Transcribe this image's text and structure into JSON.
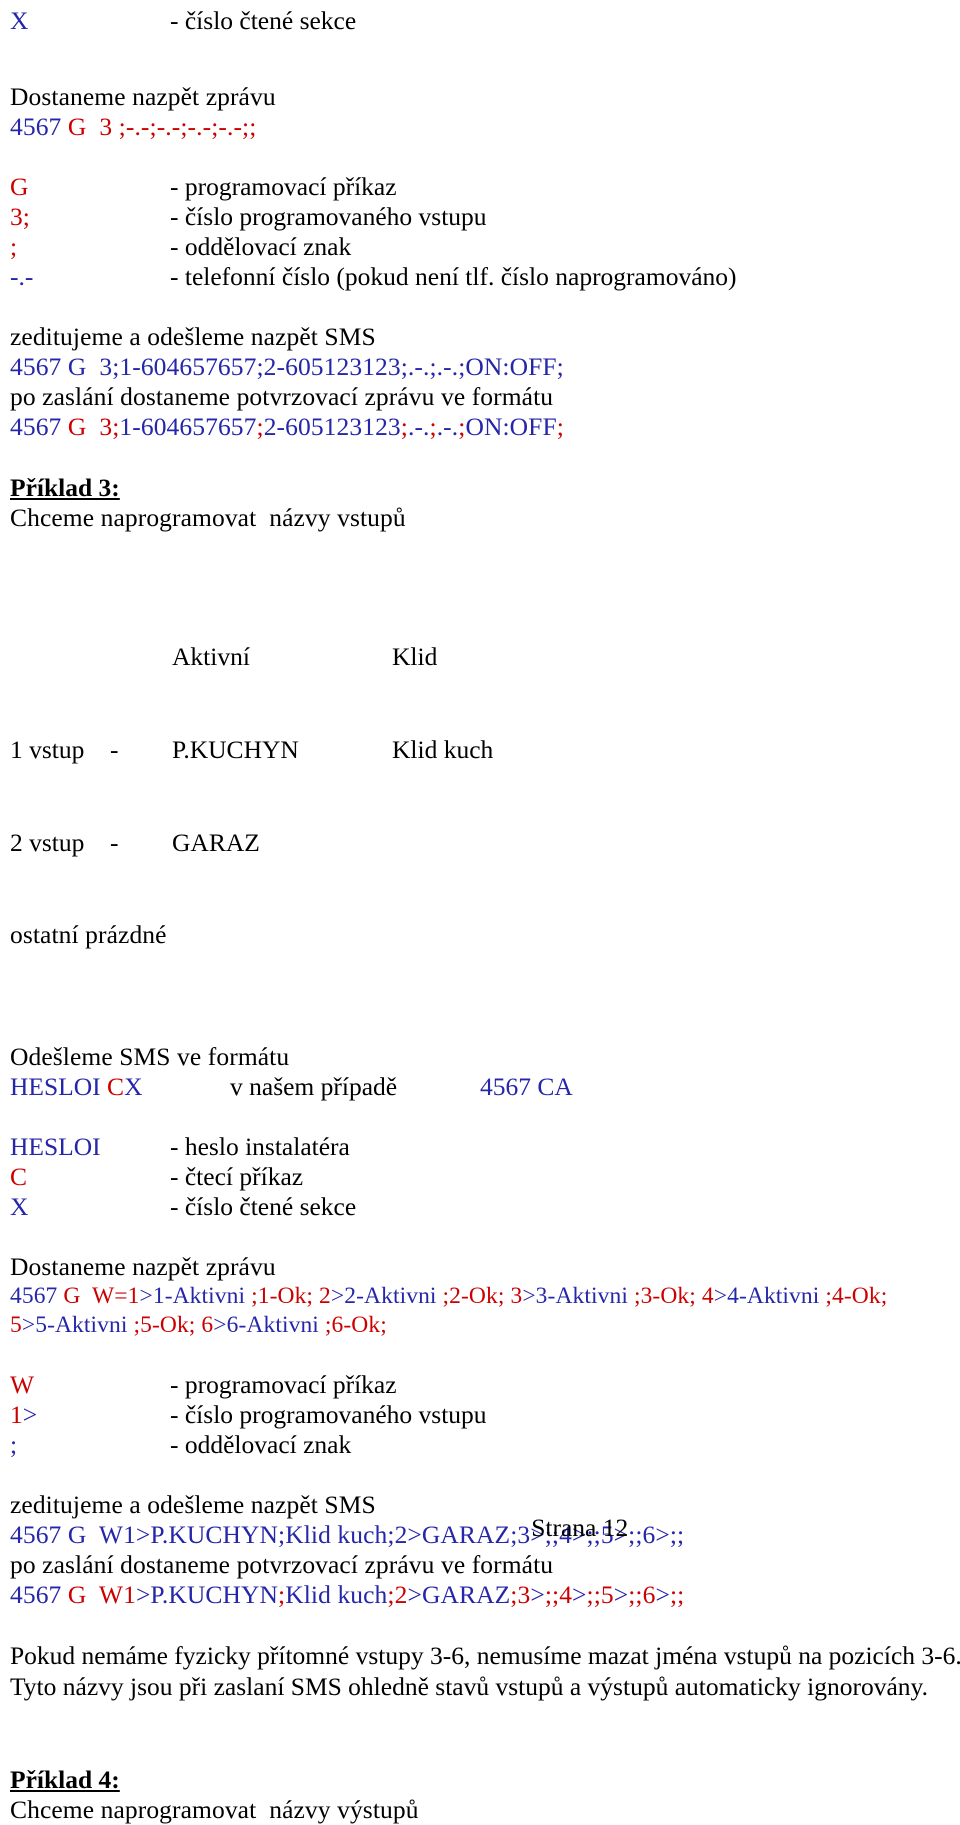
{
  "colors": {
    "blue": "#2526a9",
    "red": "#cc0000",
    "black": "#000000",
    "page_background": "#ffffff"
  },
  "section_read": {
    "legend_x_term": "X",
    "legend_x_desc": "- číslo čtené sekce",
    "reply_intro": "Dostaneme nazpět zprávu",
    "reply_prefix": "4567",
    "reply_cmd": "G",
    "reply_rest": "3 ;-.-;-.-;-.-;-.-;;",
    "legend": [
      {
        "term": "G",
        "desc": "- programovací příkaz"
      },
      {
        "term": "3;",
        "desc": "- číslo programovaného vstupu"
      },
      {
        "term": ";",
        "desc": "- oddělovací znak"
      },
      {
        "term": "-.-",
        "desc": "- telefonní číslo (pokud není tlf. číslo naprogramováno)"
      }
    ],
    "edit_intro": "zeditujeme a odešleme nazpět SMS",
    "edit_sms_prefix": "4567 G  3;1-604657657;2-605123123;.-.;.-.;ON:OFF;",
    "confirm_intro": "po zaslání dostaneme potvrzovací zprávu ve formátu",
    "confirm_num": "4567",
    "confirm_cmd": "G",
    "confirm_inp": "3",
    "confirm_sep1": ";",
    "confirm_body1": "1-604657657",
    "confirm_sep2": ";",
    "confirm_body2": "2-605123123",
    "confirm_sep3": ";",
    "confirm_body3": ".-.",
    "confirm_sep4": ";",
    "confirm_body4": ".-.",
    "confirm_sep5": ";",
    "confirm_body5": "ON:OFF",
    "confirm_sep6": ";"
  },
  "example3": {
    "heading": "Příklad 3:",
    "subtitle": "Chceme naprogramovat  názvy vstupů",
    "table": {
      "col_active": "Aktivní",
      "col_idle": "Klid",
      "rows": [
        {
          "label": "1 vstup",
          "dash": "-",
          "active": "P.KUCHYN",
          "idle": "Klid kuch"
        },
        {
          "label": "2 vstup",
          "dash": "-",
          "active": "GARAZ",
          "idle": ""
        }
      ],
      "note": "ostatní prázdné"
    },
    "send_intro": "Odešleme SMS ve formátu",
    "send_pass": "HESLOI",
    "send_cmd": "C",
    "send_sec": "X",
    "send_mid": "v našem případě",
    "send_example": "4567 CA",
    "legend": [
      {
        "term": "HESLOI",
        "desc": "- heslo instalatéra",
        "color": "blue"
      },
      {
        "term": "C",
        "desc": "- čtecí příkaz",
        "color": "red"
      },
      {
        "term": "X",
        "desc": "- číslo čtené sekce",
        "color": "blue"
      }
    ],
    "reply_intro": "Dostaneme nazpět zprávu",
    "reply_num": "4567",
    "reply_cmd": "G",
    "reply_w": "W=1",
    "reply_items": [
      {
        "gt": ">1-Aktivni ",
        "sep": ";1-Ok; "
      },
      {
        "idx": "2",
        "gt": ">2-Aktivni ",
        "sep": ";2-Ok; "
      },
      {
        "idx": "3",
        "gt": ">3-Aktivni ",
        "sep": ";3-Ok; "
      },
      {
        "idx": "4",
        "gt": ">4-Aktivni ",
        "sep": ";4-Ok;"
      }
    ],
    "reply_line2": [
      {
        "idx": "5",
        "gt": ">5-Aktivni ",
        "sep": ";5-Ok; "
      },
      {
        "idx": "6",
        "gt": ">6-Aktivni ",
        "sep": ";6-Ok;"
      }
    ],
    "legend2": [
      {
        "term": "W",
        "desc": "- programovací příkaz"
      },
      {
        "term": "1>",
        "desc": "- číslo programovaného vstupu"
      },
      {
        "term": ";",
        "desc": "- oddělovací znak"
      }
    ],
    "edit_intro": "zeditujeme a odešleme nazpět SMS",
    "edit_sms_num": "4567",
    "edit_sms_cmd": "G",
    "edit_sms_body": "W1>P.KUCHYN;Klid kuch;2>GARAZ;3>;;4>;;5>;;6>;;",
    "confirm_intro": "po zaslání dostaneme potvrzovací zprávu ve formátu",
    "confirm_num": "4567",
    "confirm_cmd": "G",
    "confirm_w": "W1",
    "confirm_gt1": ">P.KUCHYN",
    "confirm_s1": ";",
    "confirm_b1": "Klid kuch",
    "confirm_s2": ";",
    "confirm_i2": "2",
    "confirm_b2": ">GARAZ",
    "confirm_s3": ";",
    "confirm_i3": "3",
    "confirm_b3": ">",
    "confirm_s4": ";;",
    "confirm_i4": "4",
    "confirm_b4": ">",
    "confirm_s5": ";;",
    "confirm_i5": "5",
    "confirm_b5": ">",
    "confirm_s6": ";;",
    "confirm_i6": "6",
    "confirm_b6": ">",
    "confirm_s7": ";;",
    "note_line1": "Pokud nemáme fyzicky přítomné vstupy 3-6, nemusíme mazat jména vstupů na pozicích 3-6.",
    "note_line2": "Tyto názvy jsou při zaslaní SMS ohledně stavů vstupů a výstupů automaticky ignorovány."
  },
  "example4": {
    "heading": "Příklad 4:",
    "subtitle": "Chceme naprogramovat  názvy výstupů"
  },
  "footer": {
    "page_label": "Strana 12"
  }
}
